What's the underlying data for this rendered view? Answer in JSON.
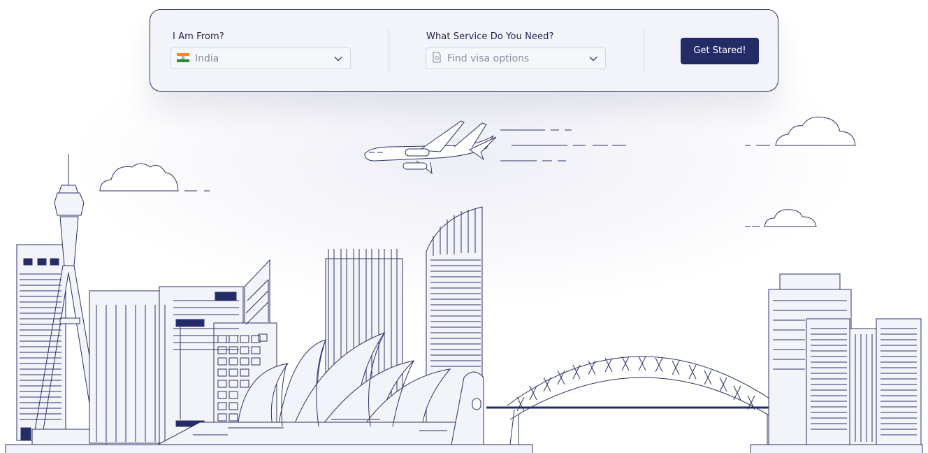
{
  "search": {
    "origin": {
      "label": "I Am From?",
      "value": "India",
      "icon": "india-flag-icon"
    },
    "service": {
      "label": "What Service Do You Need?",
      "placeholder": "Find visa options",
      "icon": "document-icon"
    },
    "cta_label": "Get Stared!"
  },
  "colors": {
    "navy": "#232c66",
    "line": "#2b3266",
    "card_bg": "#f3f4fa",
    "building_fill": "#f3f4fa"
  }
}
